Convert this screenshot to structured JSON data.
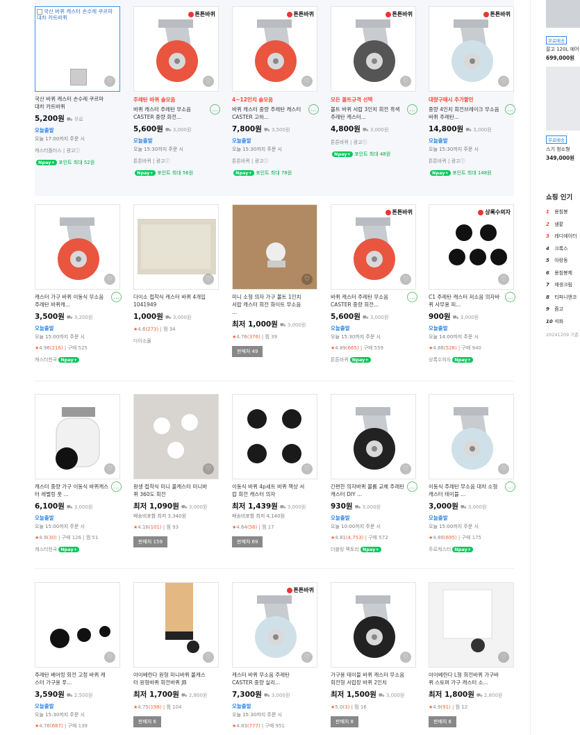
{
  "side": {
    "ad1": {
      "tag": "무료배송",
      "text": "잘고 120L 에어",
      "price": "699,000원"
    },
    "ad2": {
      "tag": "무료배송",
      "text": "스기 청소형 ",
      "price": "349,000원"
    },
    "popular_title": "쇼핑 인기",
    "popular": [
      {
        "rank": "1",
        "label": "용침봉"
      },
      {
        "rank": "2",
        "label": "샘팥"
      },
      {
        "rank": "3",
        "label": "레디에이터"
      },
      {
        "rank": "4",
        "label": "크록스"
      },
      {
        "rank": "5",
        "label": "아랑동"
      },
      {
        "rank": "6",
        "label": "용침봉제"
      },
      {
        "rank": "7",
        "label": "재생크림"
      },
      {
        "rank": "8",
        "label": "티파니앤코"
      },
      {
        "rank": "9",
        "label": "즘고"
      },
      {
        "rank": "10",
        "label": "석화"
      }
    ],
    "date": "20241209 기준"
  },
  "products": [
    {
      "img_alt": "국산 바퀴 캐스터 손수레 쿠르마 대차 카트바퀴",
      "name": "국산 바퀴 캐스터 손수레 쿠르마 대차 카트바퀴",
      "price": "5,200원",
      "ship": "무료",
      "today": "오늘출발",
      "until": "오늘 17:00까지 주문 시",
      "seller": "캐스터플러스 | 광고ⓘ",
      "points": "포인트 최대 52원"
    },
    {
      "promo": "주레탄 바퀴 솔모음",
      "brand": "튼튼바퀴",
      "name": "바퀴 캐스터 주레탄 무소음 CASTER 중량 회전...",
      "price": "5,600원",
      "ship": "3,000원",
      "today": "오늘출발",
      "until": "오늘 15:30까지 주문 시",
      "seller": "튼튼바퀴 | 광고ⓘ",
      "points": "포인트 최대 56원",
      "talk": true
    },
    {
      "promo": "4~12인치 솔모음",
      "brand": "튼튼바퀴",
      "name": "바퀴 캐스터 중량 주레탄 캐스터 CASTER 고하...",
      "price": "7,800원",
      "ship": "3,500원",
      "today": "오늘출발",
      "until": "오늘 15:30까지 주문 시",
      "seller": "튼튼바퀴 | 광고ⓘ",
      "points": "포인트 최대 78원",
      "talk": true
    },
    {
      "promo": "모든 볼트규격 선택",
      "brand": "튼튼바퀴",
      "name": "볼트 바퀴 서랍 3인치 회전 흑색 주레탄 캐스터...",
      "price": "4,800원",
      "ship": "3,000원",
      "seller": "튼튼바퀴 | 광고ⓘ",
      "points": "포인트 최대 48원",
      "talk": true
    },
    {
      "promo": "대량구매시 추가할인",
      "brand": "튼튼바퀴",
      "name": "중량 4인치 회전브레이크 무소음 바퀴 주레탄...",
      "price": "14,800원",
      "ship": "3,000원",
      "today": "오늘출발",
      "until": "오늘 15:30까지 주문 시",
      "seller": "튼튼바퀴 | 광고ⓘ",
      "points": "포인트 최대 148원",
      "talk": true
    },
    {
      "name": "캐스터 가구 바퀴 이동식 무소음 주레탄 바퀴캐...",
      "price": "3,500원",
      "ship": "3,200원",
      "today": "오늘출발",
      "until": "오늘 15:00까지 주문 시",
      "rating": "4.96",
      "reviews": "(216)",
      "buys": "구매 525",
      "seller": "캐스터천국",
      "npay": true,
      "talk": true
    },
    {
      "name": "다이소 접착식 캐스터 바퀴 4개입 1041949",
      "price": "1,000원",
      "ship": "3,000원",
      "rating": "4.6",
      "reviews": "(273)",
      "buys": "찜 34",
      "seller": "다이소몰"
    },
    {
      "name": "미니 소형 의자 가구 볼트 1인치 서랍 캐스터 회전 화이트 무소음 ...",
      "price": "1,000원",
      "min": "최저",
      "ship": "3,000원",
      "rating": "4.76",
      "reviews": "(376)",
      "buys": "찜 39",
      "compare": "판매처 49"
    },
    {
      "name": "바퀴 캐스터 주레탄 무소음 CASTER 중량 회전...",
      "brand": "튼튼바퀴",
      "price": "5,600원",
      "ship": "3,000원",
      "today": "오늘출발",
      "until": "오늘 15:30까지 주문 시",
      "rating": "4.89",
      "reviews": "(665)",
      "buys": "구매 559",
      "seller": "튼튼바퀴",
      "npay": true,
      "talk": true
    },
    {
      "name": "C1 주레탄 캐스터 저소음 의자바퀴 사무용 피...",
      "brand": "상록수의자",
      "price": "900원",
      "ship": "3,000원",
      "today": "오늘출발",
      "until": "오늘 14:00까지 주문 시",
      "rating": "4.88",
      "reviews": "(528)",
      "buys": "구매 940",
      "seller": "상록수의자",
      "npay": true,
      "talk": true
    },
    {
      "name": "캐스터 중량 가구 이동식 바퀴캐스터 레벨링 풋 ...",
      "price": "6,100원",
      "ship": "3,000원",
      "today": "오늘출발",
      "until": "오늘 15:00까지 주문 시",
      "rating": "4.9",
      "reviews": "(30)",
      "buys": "구매 126 | 찜 51",
      "seller": "캐스터천국",
      "npay": true,
      "talk": true
    },
    {
      "name": "원생 접착식 미니 볼캐스터 미니바퀴 360도 회전",
      "price": "1,090원",
      "min": "최저",
      "ship": "3,000원",
      "sub": "배송비포함 최저 3,340원",
      "rating": "4.16",
      "reviews": "(101)",
      "buys": "찜 93",
      "compare": "판매처 159"
    },
    {
      "name": "이동식 바퀴 4p세트 바퀴 책상 서랍 회전 캐스터 의자",
      "price": "1,439원",
      "min": "최저",
      "ship": "3,000원",
      "sub": "배송비포함 최저 4,140원",
      "rating": "4.64",
      "reviews": "(56)",
      "buys": "찜 17",
      "compare": "판매처 69"
    },
    {
      "name": "간편한 의자바퀴 볼륨 교체 주레탄 캐스터 DIY ...",
      "price": "930원",
      "ship": "3,000원",
      "today": "오늘출발",
      "until": "오늘 10:00까지 주문 시",
      "rating": "4.81",
      "reviews": "(4,753)",
      "buys": "구매 572",
      "seller": "더블링 팩토리",
      "npay": true,
      "talk": true
    },
    {
      "name": "이동식 주레탄 무소음 대차 소형 캐스터 테이블 ...",
      "price": "3,000원",
      "ship": "3,000원",
      "today": "오늘출발",
      "until": "오늘 15:00까지 주문 시",
      "rating": "4.89",
      "reviews": "(695)",
      "buys": "구매 175",
      "seller": "주로캐스터",
      "npay": true,
      "talk": true
    },
    {
      "name": "주레탄 베어링 회전 고정 바퀴 캐스터 가구용 푸...",
      "price": "3,590원",
      "ship": "2,500원",
      "today": "오늘출발",
      "until": "오늘 15:30까지 주문 시",
      "rating": "4.76",
      "reviews": "(687)",
      "buys": "구매 139"
    },
    {
      "name": "아이베란다 원형 미니바퀴 볼캐스터 원형바퀴 회전바퀴 JB",
      "price": "1,700원",
      "min": "최저",
      "ship": "2,800원",
      "rating": "4.75",
      "reviews": "(198)",
      "buys": "찜 104",
      "compare": "판매처 6"
    },
    {
      "name": "캐스터 바퀴 무소음 주레탄 CASTER 중량 실리...",
      "brand": "튼튼바퀴",
      "price": "7,300원",
      "ship": "3,000원",
      "today": "오늘출발",
      "until": "오늘 15:30까지 주문 시",
      "rating": "4.83",
      "reviews": "(777)",
      "buys": "구매 951"
    },
    {
      "name": "가구용 테이블 바퀴 캐스터 무소음 회전형 서랍장 바퀴 2인치",
      "price": "1,500원",
      "min": "최저",
      "ship": "3,000원",
      "rating": "5.0",
      "reviews": "(3)",
      "buys": "찜 16",
      "compare": "판매처 8"
    },
    {
      "name": "아이베란다 L형 회전바퀴 가구바퀴 스토퍼 가구 캐스터 소...",
      "price": "1,800원",
      "min": "최저",
      "ship": "2,800원",
      "rating": "4.9",
      "reviews": "(91)",
      "buys": "찜 12",
      "compare": "판매처 6"
    }
  ]
}
